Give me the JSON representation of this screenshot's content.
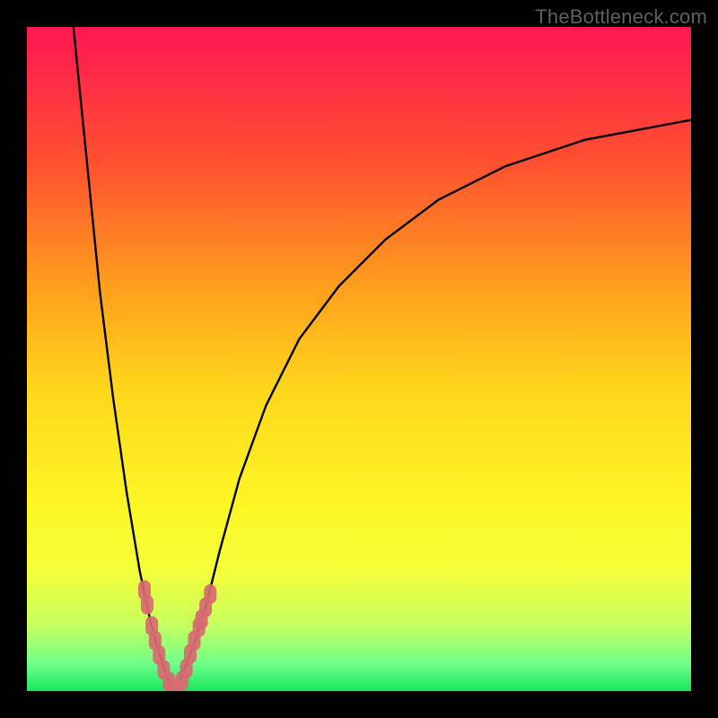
{
  "watermark": "TheBottleneck.com",
  "chart_data": {
    "type": "line",
    "title": "",
    "xlabel": "",
    "ylabel": "",
    "xlim": [
      0,
      100
    ],
    "ylim": [
      0,
      100
    ],
    "grid": false,
    "series": [
      {
        "name": "left-curve",
        "x": [
          7,
          9,
          11,
          13,
          15,
          17,
          18.5,
          19.5,
          20.5,
          21.3,
          22
        ],
        "y": [
          100,
          80,
          60,
          44,
          30,
          18,
          11,
          7,
          4,
          1.5,
          0
        ]
      },
      {
        "name": "right-curve",
        "x": [
          22,
          23,
          24,
          25.5,
          27,
          29,
          32,
          36,
          41,
          47,
          54,
          62,
          72,
          84,
          100
        ],
        "y": [
          0,
          1.5,
          4,
          8,
          13,
          21,
          32,
          43,
          53,
          61,
          68,
          74,
          79,
          83,
          86
        ]
      }
    ],
    "markers": {
      "name": "data-points",
      "color": "#d86a70",
      "points": [
        {
          "x": 17.7,
          "y": 15.2
        },
        {
          "x": 18.1,
          "y": 13.0
        },
        {
          "x": 18.8,
          "y": 9.8
        },
        {
          "x": 19.3,
          "y": 7.6
        },
        {
          "x": 19.9,
          "y": 5.4
        },
        {
          "x": 20.6,
          "y": 3.2
        },
        {
          "x": 21.4,
          "y": 1.4
        },
        {
          "x": 22.0,
          "y": 0.4
        },
        {
          "x": 22.6,
          "y": 0.4
        },
        {
          "x": 23.4,
          "y": 1.6
        },
        {
          "x": 24.0,
          "y": 3.4
        },
        {
          "x": 24.6,
          "y": 5.6
        },
        {
          "x": 25.2,
          "y": 7.6
        },
        {
          "x": 25.9,
          "y": 9.6
        },
        {
          "x": 26.3,
          "y": 10.8
        },
        {
          "x": 26.9,
          "y": 12.6
        },
        {
          "x": 27.6,
          "y": 14.6
        }
      ]
    },
    "background_gradient": {
      "stops": [
        {
          "offset": 0.0,
          "color": "#ff1752"
        },
        {
          "offset": 0.2,
          "color": "#ff4f30"
        },
        {
          "offset": 0.4,
          "color": "#ffa21c"
        },
        {
          "offset": 0.55,
          "color": "#ffd81c"
        },
        {
          "offset": 0.72,
          "color": "#fdf624"
        },
        {
          "offset": 0.82,
          "color": "#f4ff3a"
        },
        {
          "offset": 0.9,
          "color": "#c7ff5e"
        },
        {
          "offset": 0.96,
          "color": "#6eff8a"
        },
        {
          "offset": 1.0,
          "color": "#17e65d"
        }
      ]
    }
  }
}
